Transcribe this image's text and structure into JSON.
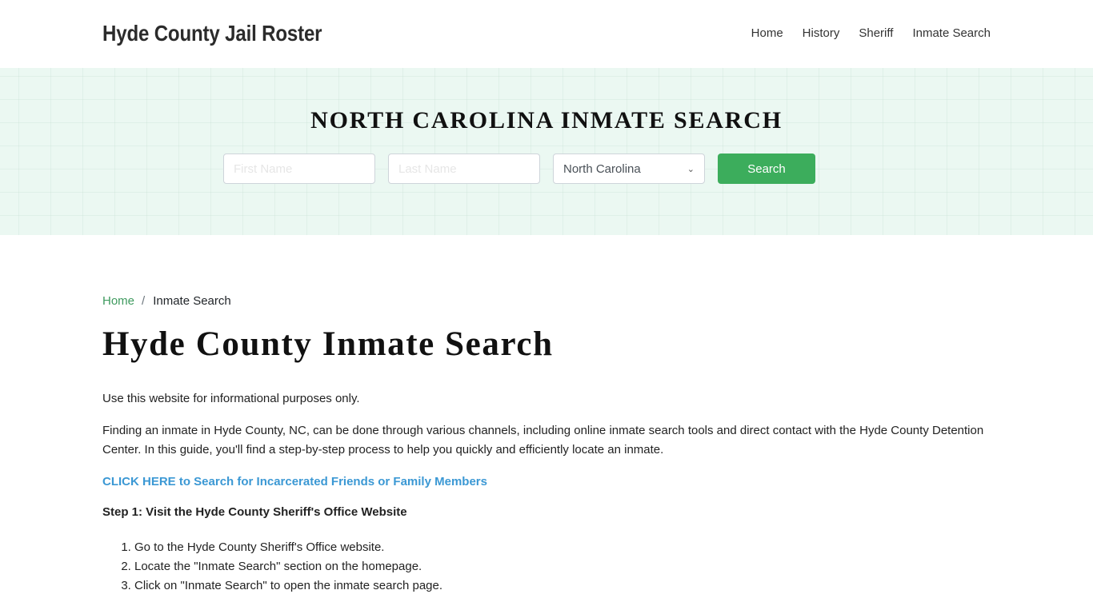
{
  "header": {
    "brand": "Hyde County Jail Roster",
    "nav": [
      {
        "label": "Home"
      },
      {
        "label": "History"
      },
      {
        "label": "Sheriff"
      },
      {
        "label": "Inmate Search"
      }
    ]
  },
  "hero": {
    "title": "NORTH CAROLINA INMATE SEARCH",
    "first_name_placeholder": "First Name",
    "first_name_value": "",
    "last_name_placeholder": "Last Name",
    "last_name_value": "",
    "state_selected": "North Carolina",
    "search_label": "Search",
    "colors": {
      "background": "#ebf8f2",
      "button": "#3cad5c"
    }
  },
  "breadcrumb": {
    "home": "Home",
    "separator": "/",
    "current": "Inmate Search"
  },
  "main": {
    "title": "Hyde County Inmate Search",
    "intro": "Use this website for informational purposes only.",
    "paragraph": "Finding an inmate in Hyde County, NC, can be done through various channels, including online inmate search tools and direct contact with the Hyde County Detention Center. In this guide, you'll find a step-by-step process to help you quickly and efficiently locate an inmate.",
    "cta_link": "CLICK HERE to Search for Incarcerated Friends or Family Members",
    "step1_heading": "Step 1: Visit the Hyde County Sheriff's Office Website",
    "step1_items": [
      "Go to the Hyde County Sheriff's Office website.",
      "Locate the \"Inmate Search\" section on the homepage.",
      "Click on \"Inmate Search\" to open the inmate search page."
    ],
    "colors": {
      "link": "#3b98d4",
      "breadcrumb_link": "#3e9a5e"
    }
  }
}
